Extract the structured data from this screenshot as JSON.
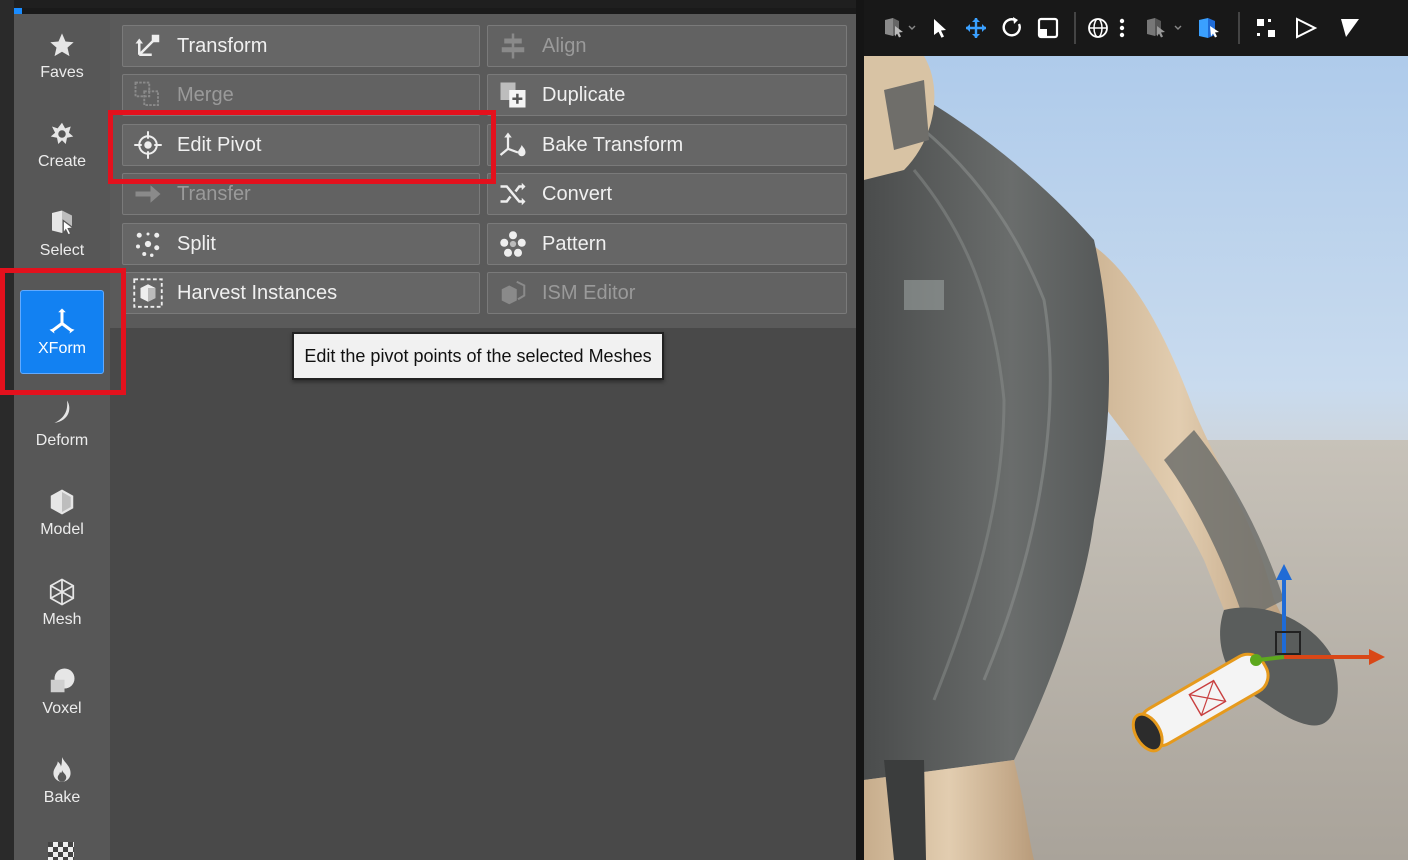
{
  "sidebar": {
    "categories": [
      {
        "label": "Faves",
        "icon": "star-icon"
      },
      {
        "label": "Create",
        "icon": "create-icon"
      },
      {
        "label": "Select",
        "icon": "select-icon"
      },
      {
        "label": "XForm",
        "icon": "xform-icon",
        "active": true
      },
      {
        "label": "Deform",
        "icon": "deform-icon"
      },
      {
        "label": "Model",
        "icon": "model-icon"
      },
      {
        "label": "Mesh",
        "icon": "mesh-icon"
      },
      {
        "label": "Voxel",
        "icon": "voxel-icon"
      },
      {
        "label": "Bake",
        "icon": "bake-icon"
      }
    ]
  },
  "tools": {
    "transform": "Transform",
    "align": "Align",
    "merge": "Merge",
    "duplicate": "Duplicate",
    "edit_pivot": "Edit Pivot",
    "bake_transform": "Bake Transform",
    "transfer": "Transfer",
    "convert": "Convert",
    "split": "Split",
    "pattern": "Pattern",
    "harvest_instances": "Harvest Instances",
    "ism_editor": "ISM Editor"
  },
  "tooltip": "Edit the pivot points of the selected Meshes",
  "colors": {
    "accent": "#1281f2",
    "highlight": "#e3111d",
    "panel": "#5a5a5a"
  }
}
